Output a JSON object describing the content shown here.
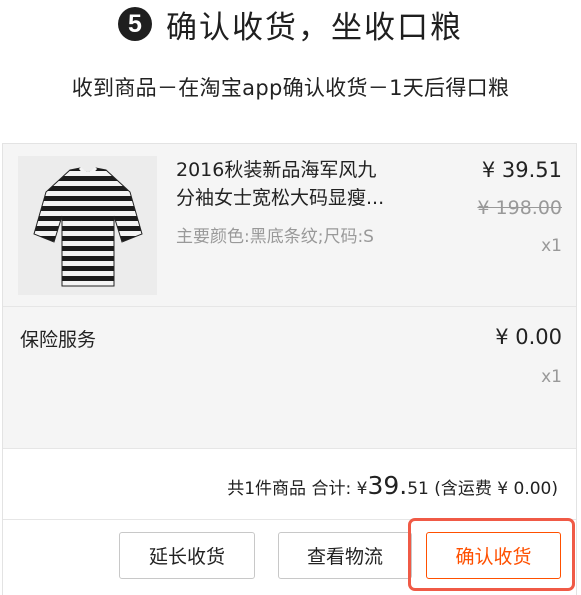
{
  "step": {
    "number": "5",
    "title": "确认收货，坐收口粮"
  },
  "subtitle": "收到商品－在淘宝app确认收货－1天后得口粮",
  "order": {
    "item": {
      "title_line1": "2016秋装新品海军风九",
      "title_line2": "分袖女士宽松大码显瘦...",
      "sku": "主要颜色:黑底条纹;尺码:S",
      "price": "¥ 39.51",
      "original_price": "¥ 198.00",
      "quantity": "x1"
    },
    "insurance": {
      "label": "保险服务",
      "price": "¥ 0.00",
      "quantity": "x1"
    },
    "summary": {
      "count_text": "共1件商品",
      "total_label": "合计:",
      "currency": "¥",
      "total_int": "39.",
      "total_dec": "51",
      "shipping_text": "(含运费 ¥ 0.00)"
    },
    "actions": {
      "extend_label": "延长收货",
      "logistics_label": "查看物流",
      "confirm_label": "确认收货"
    }
  },
  "colors": {
    "accent": "#ff5000",
    "highlight": "#f05a46"
  },
  "icons": {
    "step_badge": "circled-number-5"
  }
}
